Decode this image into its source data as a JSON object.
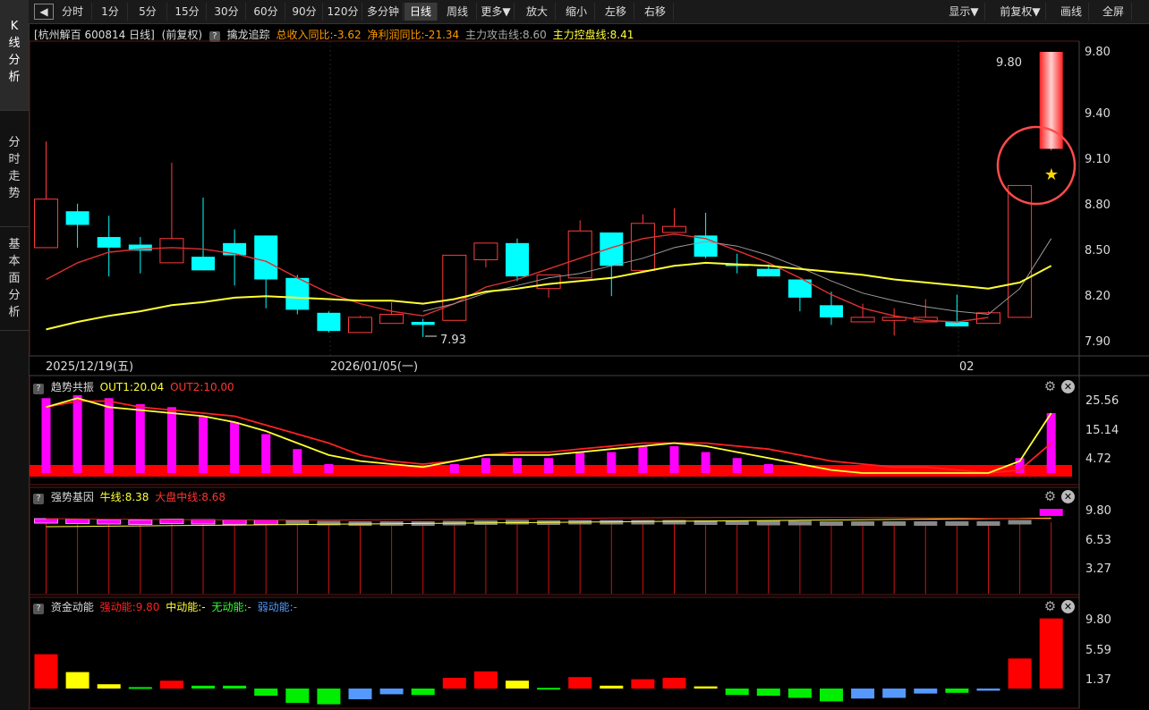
{
  "toolbar": {
    "back_icon": "back-arrow-icon",
    "periods": [
      "分时",
      "1分",
      "5分",
      "15分",
      "30分",
      "60分",
      "90分",
      "120分",
      "多分钟",
      "日线",
      "周线",
      "更多▼"
    ],
    "active_period": "日线",
    "actions": [
      "放大",
      "缩小",
      "左移",
      "右移"
    ],
    "right": [
      "显示▼",
      "前复权▼",
      "画线",
      "全屏"
    ]
  },
  "sidebar": {
    "items": [
      {
        "label": "K线分析",
        "active": true
      },
      {
        "label": "分时走势",
        "active": false
      },
      {
        "label": "基本面分析",
        "active": false
      }
    ]
  },
  "kline_header": {
    "stock": "[杭州解百 600814 日线]",
    "adjust": "(前复权)",
    "indicator": "擒龙追踪",
    "revenue": "总收入同比:-3.62",
    "profit": "净利润同比:-21.34",
    "attack": "主力攻击线:8.60",
    "control": "主力控盘线:8.41"
  },
  "kline_axis": {
    "ticks": [
      "9.80",
      "9.40",
      "9.10",
      "8.80",
      "8.50",
      "8.20",
      "7.90"
    ],
    "date_labels": [
      "2025/12/19(五)",
      "2026/01/05(一)",
      "02"
    ],
    "high_label": "9.80",
    "low_label": "7.93"
  },
  "trend_panel": {
    "title": "趋势共振",
    "out1": "OUT1:20.04",
    "out2": "OUT2:10.00",
    "ticks": [
      "25.56",
      "15.14",
      "4.72"
    ]
  },
  "gene_panel": {
    "title": "强势基因",
    "niu": "牛线:8.38",
    "dapan": "大盘中线:8.68",
    "ticks": [
      "9.80",
      "6.53",
      "3.27"
    ]
  },
  "fund_panel": {
    "title": "资金动能",
    "strong": "强动能:9.80",
    "mid": "中动能:-",
    "none": "无动能:-",
    "weak": "弱动能:-",
    "ticks": [
      "9.80",
      "5.59",
      "1.37"
    ]
  },
  "colors": {
    "up": "#ff3b3b",
    "down": "#00ffff",
    "ma_yellow": "#ffff33",
    "ma_gray": "#999999",
    "magenta": "#ff00ff",
    "fund_red": "#ff0000",
    "fund_yellow": "#ffff00",
    "fund_green": "#00ee00",
    "fund_blue": "#5599ff"
  },
  "chart_data": [
    {
      "type": "candlestick",
      "title": "杭州解百 600814 日线",
      "ylim": [
        7.85,
        9.85
      ],
      "candles": [
        {
          "o": 8.52,
          "h": 9.22,
          "l": 8.52,
          "c": 8.84
        },
        {
          "o": 8.76,
          "h": 8.81,
          "l": 8.52,
          "c": 8.67
        },
        {
          "o": 8.59,
          "h": 8.73,
          "l": 8.33,
          "c": 8.52
        },
        {
          "o": 8.54,
          "h": 8.59,
          "l": 8.35,
          "c": 8.5
        },
        {
          "o": 8.42,
          "h": 9.08,
          "l": 8.42,
          "c": 8.58
        },
        {
          "o": 8.46,
          "h": 8.85,
          "l": 8.37,
          "c": 8.37
        },
        {
          "o": 8.55,
          "h": 8.64,
          "l": 8.27,
          "c": 8.47
        },
        {
          "o": 8.6,
          "h": 8.6,
          "l": 8.12,
          "c": 8.31
        },
        {
          "o": 8.32,
          "h": 8.34,
          "l": 8.08,
          "c": 8.11
        },
        {
          "o": 8.09,
          "h": 8.1,
          "l": 7.96,
          "c": 7.97
        },
        {
          "o": 7.96,
          "h": 8.07,
          "l": 7.96,
          "c": 8.06
        },
        {
          "o": 8.02,
          "h": 8.16,
          "l": 8.02,
          "c": 8.08
        },
        {
          "o": 8.03,
          "h": 8.05,
          "l": 7.93,
          "c": 8.01
        },
        {
          "o": 8.04,
          "h": 8.47,
          "l": 8.04,
          "c": 8.47
        },
        {
          "o": 8.44,
          "h": 8.55,
          "l": 8.39,
          "c": 8.55
        },
        {
          "o": 8.55,
          "h": 8.58,
          "l": 8.3,
          "c": 8.33
        },
        {
          "o": 8.25,
          "h": 8.34,
          "l": 8.19,
          "c": 8.34
        },
        {
          "o": 8.32,
          "h": 8.7,
          "l": 8.32,
          "c": 8.63
        },
        {
          "o": 8.62,
          "h": 8.62,
          "l": 8.2,
          "c": 8.4
        },
        {
          "o": 8.37,
          "h": 8.74,
          "l": 8.37,
          "c": 8.68
        },
        {
          "o": 8.62,
          "h": 8.78,
          "l": 8.62,
          "c": 8.66
        },
        {
          "o": 8.6,
          "h": 8.75,
          "l": 8.45,
          "c": 8.46
        },
        {
          "o": 8.41,
          "h": 8.48,
          "l": 8.35,
          "c": 8.4
        },
        {
          "o": 8.38,
          "h": 8.41,
          "l": 8.33,
          "c": 8.33
        },
        {
          "o": 8.31,
          "h": 8.31,
          "l": 8.1,
          "c": 8.19
        },
        {
          "o": 8.14,
          "h": 8.23,
          "l": 8.01,
          "c": 8.06
        },
        {
          "o": 8.03,
          "h": 8.15,
          "l": 8.03,
          "c": 8.06
        },
        {
          "o": 8.04,
          "h": 8.12,
          "l": 7.94,
          "c": 8.06
        },
        {
          "o": 8.03,
          "h": 8.18,
          "l": 8.03,
          "c": 8.06
        },
        {
          "o": 8.03,
          "h": 8.21,
          "l": 8.01,
          "c": 8.0
        },
        {
          "o": 8.02,
          "h": 8.1,
          "l": 8.02,
          "c": 8.09
        },
        {
          "o": 8.06,
          "h": 8.93,
          "l": 8.06,
          "c": 8.93
        },
        {
          "o": 9.16,
          "h": 9.8,
          "l": 9.16,
          "c": 9.8
        }
      ],
      "ma_yellow": [
        7.98,
        8.03,
        8.07,
        8.1,
        8.14,
        8.16,
        8.19,
        8.2,
        8.19,
        8.18,
        8.17,
        8.17,
        8.15,
        8.18,
        8.23,
        8.25,
        8.28,
        8.3,
        8.32,
        8.36,
        8.4,
        8.42,
        8.41,
        8.4,
        8.38,
        8.36,
        8.34,
        8.31,
        8.29,
        8.27,
        8.25,
        8.29,
        8.4
      ],
      "ma_gray": [
        null,
        null,
        null,
        null,
        null,
        null,
        null,
        null,
        null,
        null,
        null,
        null,
        8.1,
        8.15,
        8.22,
        8.27,
        8.32,
        8.35,
        8.4,
        8.45,
        8.52,
        8.56,
        8.53,
        8.47,
        8.39,
        8.3,
        8.22,
        8.17,
        8.13,
        8.1,
        8.08,
        8.25,
        8.58
      ],
      "ma_red": [
        8.31,
        8.42,
        8.49,
        8.51,
        8.52,
        8.51,
        8.48,
        8.43,
        8.32,
        8.22,
        8.15,
        8.1,
        8.07,
        8.15,
        8.26,
        8.31,
        8.38,
        8.45,
        8.52,
        8.58,
        8.61,
        8.58,
        8.5,
        8.42,
        8.32,
        8.21,
        8.12,
        8.07,
        8.04,
        8.03,
        8.06,
        null,
        null
      ]
    },
    {
      "type": "bar",
      "title": "趋势共振",
      "ylim": [
        0,
        30
      ],
      "values": [
        25,
        26,
        25,
        23,
        22,
        19,
        17,
        13,
        8,
        3,
        0,
        0,
        0,
        3,
        5,
        5,
        5,
        7,
        7,
        9,
        9,
        7,
        5,
        3,
        0,
        0,
        0,
        0,
        0,
        0,
        0,
        5,
        20
      ],
      "out1": [
        22,
        25,
        22,
        21,
        20,
        19,
        17,
        14,
        10,
        6,
        4,
        3,
        2,
        4,
        6,
        6,
        6,
        7,
        8,
        9,
        10,
        9,
        7,
        5,
        3,
        1,
        0,
        0,
        0,
        0,
        0,
        4,
        20
      ],
      "out2": [
        22,
        24,
        24,
        22,
        21,
        20,
        19,
        16,
        13,
        10,
        6,
        4,
        3,
        4,
        6,
        7,
        7,
        8,
        9,
        10,
        10,
        10,
        9,
        8,
        6,
        4,
        3,
        2,
        2,
        1,
        0,
        1,
        10
      ]
    },
    {
      "type": "bar",
      "title": "强势基因",
      "ylim": [
        0,
        10.5
      ],
      "values": [
        9.6,
        9.5,
        9.4,
        9.3,
        9.5,
        9.4,
        9.3,
        9.3,
        9.2,
        9.1,
        9.0,
        9.0,
        9.0,
        9.1,
        9.2,
        9.3,
        9.2,
        9.3,
        9.3,
        9.3,
        9.3,
        9.2,
        9.2,
        9.1,
        9.1,
        9.0,
        9.0,
        9.0,
        9.0,
        9.0,
        9.0,
        9.3,
        9.8
      ]
    },
    {
      "type": "bar",
      "title": "资金动能",
      "ylim": [
        -2,
        10
      ],
      "values": [
        4.8,
        2.3,
        0.6,
        0.2,
        1.1,
        0.4,
        0.4,
        -1.0,
        -2.0,
        -2.2,
        -1.5,
        -0.8,
        -0.9,
        1.5,
        2.4,
        1.1,
        0.1,
        1.6,
        0.4,
        1.3,
        1.5,
        0.3,
        -0.9,
        -1.0,
        -1.3,
        -1.8,
        -1.4,
        -1.3,
        -0.7,
        -0.6,
        -0.3,
        4.2,
        9.8
      ],
      "colors": [
        "r",
        "y",
        "y",
        "g",
        "r",
        "g",
        "g",
        "g",
        "g",
        "g",
        "b",
        "b",
        "g",
        "r",
        "r",
        "y",
        "g",
        "r",
        "y",
        "r",
        "r",
        "y",
        "g",
        "g",
        "g",
        "g",
        "b",
        "b",
        "b",
        "g",
        "b",
        "r",
        "r"
      ]
    }
  ]
}
